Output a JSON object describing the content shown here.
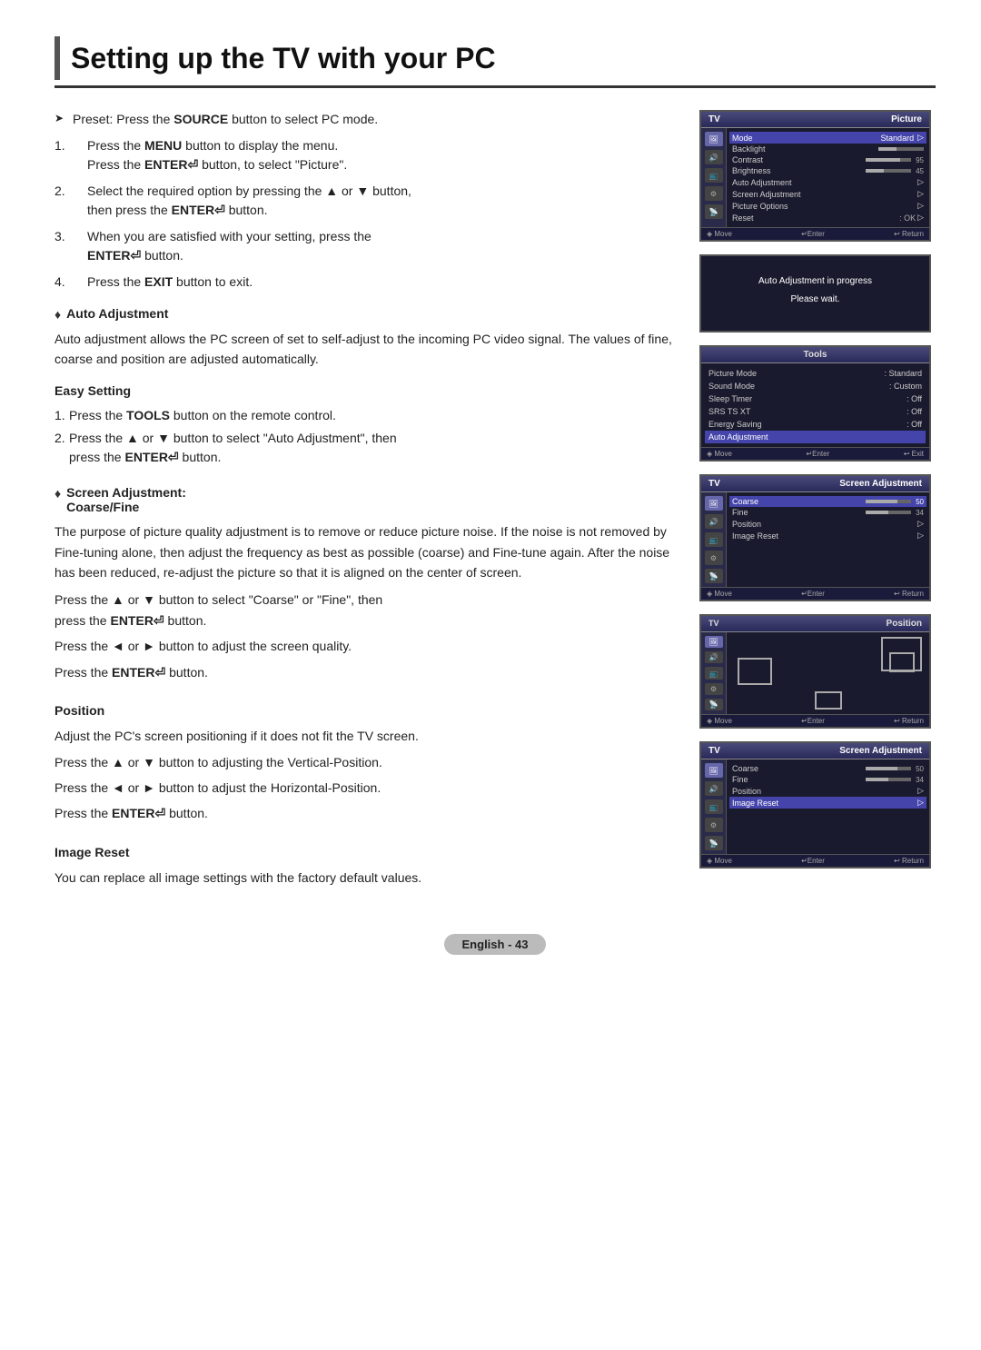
{
  "page": {
    "title": "Setting up the TV with your PC",
    "footer_label": "English - 43"
  },
  "intro": {
    "preset": "Preset: Press the SOURCE button to select PC mode.",
    "step1a": "Press the MENU button to display the menu.",
    "step1b": "Press the ENTER",
    "step1b2": " button, to select \"Picture\".",
    "step2a": "Select the required option by pressing the ▲ or ▼ button,",
    "step2b": "then press the ENTER",
    "step2b2": " button.",
    "step3a": "When you are satisfied with your setting, press the",
    "step3b": "ENTER",
    "step3c": " button.",
    "step4": "Press the EXIT button to exit."
  },
  "auto_adjustment": {
    "title": "Auto Adjustment",
    "body": "Auto adjustment allows the PC screen of set to self-adjust to the incoming PC video signal. The values of fine, coarse and position are adjusted automatically.",
    "easy_setting_title": "Easy Setting",
    "step1": "Press the TOOLS button on the remote control.",
    "step2a": "Press the ▲ or ▼ button to select \"Auto Adjustment\", then",
    "step2b": "press the ENTER",
    "step2c": " button."
  },
  "screen_adjustment": {
    "title": "Screen Adjustment:",
    "sub_title": "Coarse/Fine",
    "body1": "The purpose of picture quality adjustment is to remove or reduce picture noise. If the noise is not removed by Fine-tuning alone, then adjust the frequency as best as possible (coarse) and Fine-tune again. After the noise has been reduced, re-adjust the picture so that it is aligned on the center of screen.",
    "body2a": "Press the ▲ or ▼ button to select \"Coarse\" or \"Fine\", then",
    "body2b": "press the ENTER",
    "body2c": " button.",
    "body3": "Press the ◄ or ► button to adjust the screen quality.",
    "body4a": "Press the ENTER",
    "body4b": " button."
  },
  "position": {
    "title": "Position",
    "body1": "Adjust the PC's screen positioning if it does not fit the TV screen.",
    "body2": "Press the ▲ or ▼ button to adjusting the Vertical-Position.",
    "body3": "Press the ◄ or ► button to adjust the Horizontal-Position.",
    "body4a": "Press the ENTER",
    "body4b": " button."
  },
  "image_reset": {
    "title": "Image Reset",
    "body": "You can replace all image settings with the factory default values."
  },
  "tv_picture_screen": {
    "header_left": "TV",
    "header_right": "Picture",
    "rows": [
      {
        "label": "Mode",
        "value": "Standard",
        "type": "value"
      },
      {
        "label": "Backlight",
        "bar": 40,
        "type": "bar"
      },
      {
        "label": "Contrast",
        "value": "95",
        "bar": 75,
        "type": "bar_val"
      },
      {
        "label": "Brightness",
        "value": "45",
        "bar": 40,
        "type": "bar_val"
      },
      {
        "label": "Auto Adjustment",
        "type": "arrow"
      },
      {
        "label": "Screen Adjustment",
        "type": "arrow"
      },
      {
        "label": "Picture Options",
        "type": "arrow"
      },
      {
        "label": "Reset",
        "value": ": OK",
        "type": "value"
      }
    ],
    "footer": [
      "◈ Move",
      "↵Enter",
      "↩ Return"
    ]
  },
  "auto_adj_screen": {
    "line1": "Auto Adjustment in progress",
    "line2": "Please wait."
  },
  "tools_screen": {
    "header": "Tools",
    "rows": [
      {
        "label": "Picture Mode",
        "value": ": Standard"
      },
      {
        "label": "Sound Mode",
        "value": ": Custom"
      },
      {
        "label": "Sleep Timer",
        "value": ": Off"
      },
      {
        "label": "SRS TS XT",
        "value": ": Off"
      },
      {
        "label": "Energy Saving",
        "value": ": Off"
      }
    ],
    "active_row": "Auto Adjustment",
    "footer": [
      "◈ Move",
      "↵Enter",
      "↩ Exit"
    ]
  },
  "screen_adj_screen": {
    "header_left": "TV",
    "header_right": "Screen Adjustment",
    "rows": [
      {
        "label": "Coarse",
        "value": "50",
        "bar": 70,
        "type": "bar_val"
      },
      {
        "label": "Fine",
        "value": "34",
        "bar": 50,
        "type": "bar_val"
      },
      {
        "label": "Position",
        "type": "arrow"
      },
      {
        "label": "Image Reset",
        "type": "arrow"
      }
    ],
    "footer": [
      "◈ Move",
      "↵Enter",
      "↩ Return"
    ]
  },
  "position_screen": {
    "header_right": "Position",
    "footer": [
      "◈ Move",
      "↵Enter",
      "↩ Return"
    ]
  },
  "screen_adj_screen2": {
    "header_left": "TV",
    "header_right": "Screen Adjustment",
    "rows": [
      {
        "label": "Coarse",
        "value": "50",
        "bar": 70,
        "type": "bar_val"
      },
      {
        "label": "Fine",
        "value": "34",
        "bar": 50,
        "type": "bar_val"
      },
      {
        "label": "Position",
        "type": "arrow"
      },
      {
        "label": "Image Reset",
        "type": "arrow_highlight"
      }
    ],
    "footer": [
      "◈ Move",
      "↵Enter",
      "↩ Return"
    ]
  }
}
